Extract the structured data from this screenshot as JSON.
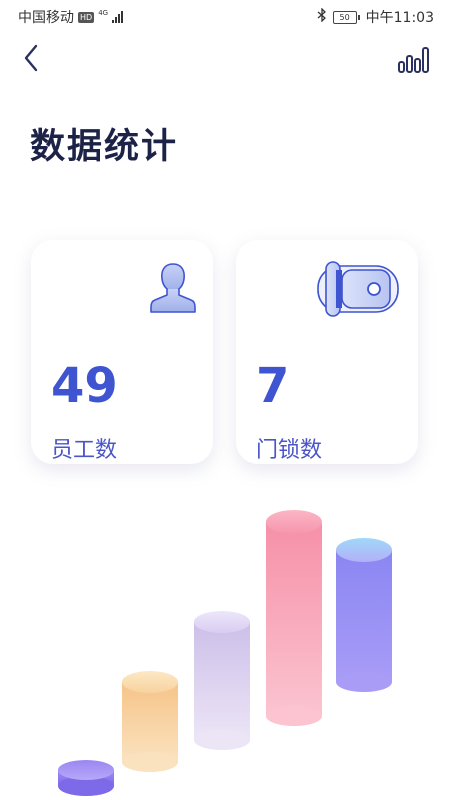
{
  "status_bar": {
    "carrier": "中国移动",
    "hd_badge": "HD",
    "network": "4G",
    "battery": "50",
    "time": "中午11:03"
  },
  "header": {
    "back_icon": "chevron-left-icon",
    "stats_icon": "bar-chart-icon"
  },
  "page": {
    "title": "数据统计"
  },
  "cards": [
    {
      "icon": "person-icon",
      "value": "49",
      "label": "员工数"
    },
    {
      "icon": "door-lock-icon",
      "value": "7",
      "label": "门锁数"
    }
  ],
  "colors": {
    "accent": "#3f54d0",
    "title": "#1d2247",
    "label": "#4a55c8"
  },
  "decoration": {
    "cylinder_colors": [
      "#8f7df0",
      "#f5c884",
      "#d6c8ee",
      "#f58fa8",
      "#9a8ff0"
    ]
  }
}
